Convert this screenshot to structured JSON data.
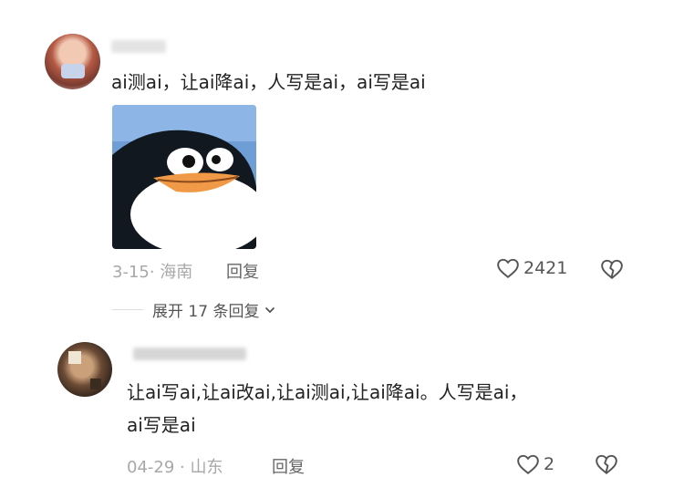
{
  "comment1": {
    "text": "ai测ai，让ai降ai，人写是ai，ai写是ai",
    "date": "3-15",
    "location": "海南",
    "reply_label": "回复",
    "likes": "2421"
  },
  "expand_label": "展开 17 条回复",
  "comment2": {
    "text_line1": "让ai写ai,让ai改ai,让ai测ai,让ai降ai。人写是ai，",
    "text_line2": "ai写是ai",
    "date": "04-29",
    "location": "山东",
    "reply_label": "回复",
    "likes": "2"
  }
}
